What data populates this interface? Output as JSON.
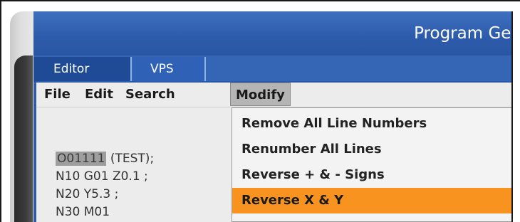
{
  "window": {
    "title": "Program Gen"
  },
  "tabs": [
    {
      "label": "Editor",
      "active": true
    },
    {
      "label": "VPS",
      "active": false
    }
  ],
  "menubar": {
    "items": [
      {
        "label": "File"
      },
      {
        "label": "Edit"
      },
      {
        "label": "Search"
      },
      {
        "label": "Modify",
        "open": true
      }
    ]
  },
  "editor": {
    "lines": [
      {
        "highlight": "O01111",
        "rest": " (TEST);"
      },
      {
        "text": "N10 G01 Z0.1 ;"
      },
      {
        "text": "N20 Y5.3 ;"
      },
      {
        "text": "N30 M01"
      }
    ]
  },
  "modify_menu": {
    "items": [
      {
        "label": "Remove All Line Numbers"
      },
      {
        "label": "Renumber All Lines"
      },
      {
        "label": "Reverse + & - Signs"
      },
      {
        "label": "Reverse X & Y",
        "highlighted": true
      }
    ]
  },
  "colors": {
    "screen_blue": "#2c59a8",
    "highlight_orange": "#f7931e",
    "menu_background": "#ececec"
  }
}
